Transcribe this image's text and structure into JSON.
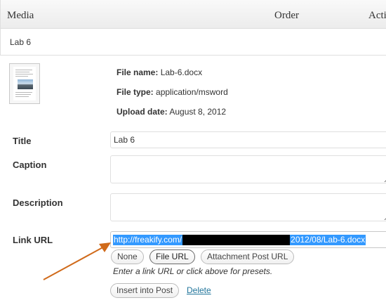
{
  "table_header": {
    "media": "Media",
    "order": "Order",
    "actions": "Acti"
  },
  "item": {
    "title": "Lab 6"
  },
  "file_info": {
    "name_label": "File name:",
    "name_value": "Lab-6.docx",
    "type_label": "File type:",
    "type_value": "application/msword",
    "date_label": "Upload date:",
    "date_value": "August 8, 2012"
  },
  "fields": {
    "title_label": "Title",
    "title_value": "Lab 6",
    "caption_label": "Caption",
    "caption_value": "",
    "description_label": "Description",
    "description_value": "",
    "link_label": "Link URL",
    "link_url_prefix": "http://freakify.com/",
    "link_url_suffix": "2012/08/Lab-6.docx"
  },
  "buttons": {
    "none": "None",
    "file_url": "File URL",
    "attachment_post_url": "Attachment Post URL",
    "insert_into_post": "Insert into Post",
    "delete": "Delete"
  },
  "hint": "Enter a link URL or click above for presets.",
  "colors": {
    "selection": "#3399ff",
    "arrow": "#d06a1a",
    "link": "#21759b"
  }
}
